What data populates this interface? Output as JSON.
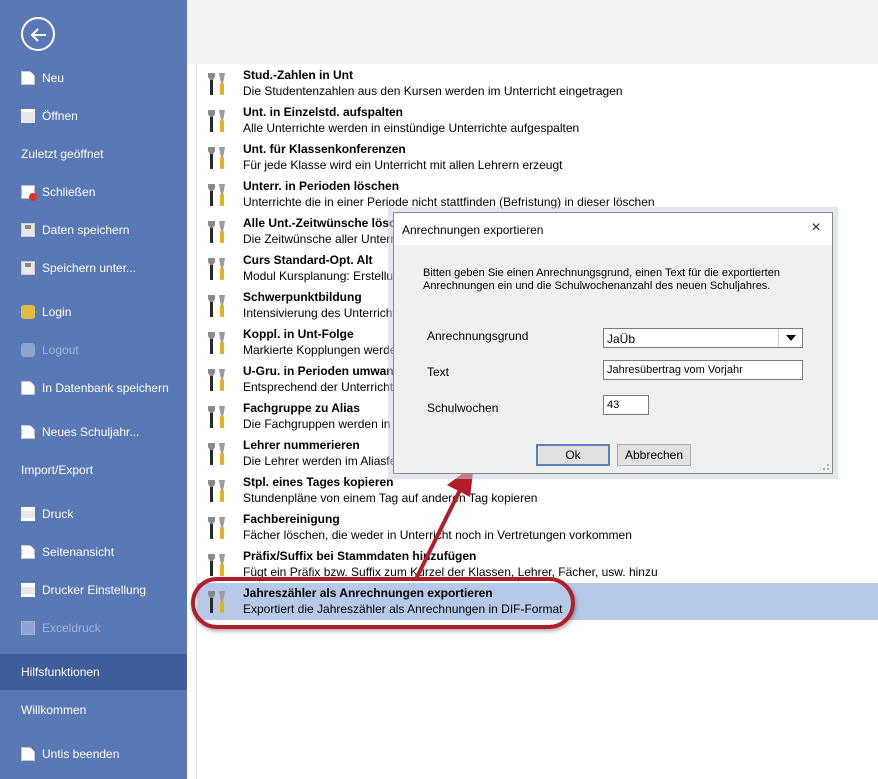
{
  "sidebar": {
    "items": [
      {
        "label": "Neu",
        "icon": "new-document-icon"
      },
      {
        "label": "Öffnen",
        "icon": "open-folder-icon"
      },
      {
        "label": "Zuletzt geöffnet"
      },
      {
        "label": "Schließen",
        "icon": "close-document-icon"
      },
      {
        "label": "Daten speichern",
        "icon": "save-disk-icon"
      },
      {
        "label": "Speichern unter...",
        "icon": "save-as-icon"
      },
      {
        "label": "Login",
        "icon": "database-icon"
      },
      {
        "label": "Logout",
        "icon": "database-icon",
        "disabled": true
      },
      {
        "label": "In Datenbank speichern",
        "icon": "database-save-icon"
      },
      {
        "label": "Neues Schuljahr...",
        "icon": "new-schoolyear-icon"
      },
      {
        "label": "Import/Export"
      },
      {
        "label": "Druck",
        "icon": "printer-icon"
      },
      {
        "label": "Seitenansicht",
        "icon": "page-preview-icon"
      },
      {
        "label": "Drucker Einstellung",
        "icon": "printer-settings-icon"
      },
      {
        "label": "Exceldruck",
        "icon": "excel-icon",
        "disabled": true
      },
      {
        "label": "Hilfsfunktionen",
        "active": true
      },
      {
        "label": "Willkommen"
      },
      {
        "label": "Untis beenden",
        "icon": "exit-icon"
      }
    ]
  },
  "functions": [
    {
      "title": "Stud.-Zahlen in Unt",
      "desc": "Die Studentenzahlen aus den Kursen werden im Unterricht eingetragen"
    },
    {
      "title": "Unt. in Einzelstd. aufspalten",
      "desc": "Alle Unterrichte werden in einstündige Unterrichte aufgespalten"
    },
    {
      "title": "Unt. für Klassenkonferenzen",
      "desc": "Für jede Klasse wird ein Unterricht mit allen Lehrern erzeugt"
    },
    {
      "title": "Unterr. in Perioden löschen",
      "desc": "Unterrichte die in einer Periode nicht stattfinden (Befristung) in dieser löschen"
    },
    {
      "title": "Alle Unt.-Zeitwünsche lösche",
      "desc": "Die Zeitwünsche aller Unterri"
    },
    {
      "title": "Curs Standard-Opt. Alt",
      "desc": "Modul Kursplanung: Erstellun"
    },
    {
      "title": "Schwerpunktbildung",
      "desc": "Intensivierung des Unterricht"
    },
    {
      "title": "Koppl. in Unt-Folge",
      "desc": "Markierte Kopplungen werde"
    },
    {
      "title": "U-Gru. in Perioden umwande",
      "desc": "Entsprechend der Unterrichts"
    },
    {
      "title": "Fachgruppe zu Alias",
      "desc": "Die Fachgruppen werden in d"
    },
    {
      "title": "Lehrer nummerieren",
      "desc": "Die Lehrer werden im Aliasfel"
    },
    {
      "title": "Stpl. eines Tages kopieren",
      "desc": "Stundenpläne von einem Tag auf anderen Tag kopieren"
    },
    {
      "title": "Fachbereinigung",
      "desc": "Fächer löschen, die weder in Unterricht noch in Vertretungen vorkommen"
    },
    {
      "title": "Präfix/Suffix bei Stammdaten hinzufügen",
      "desc": "Fügt ein Präfix bzw. Suffix zum Kürzel der Klassen, Lehrer, Fächer, usw. hinzu"
    },
    {
      "title": "Jahreszähler als Anrechnungen exportieren",
      "desc": "Exportiert die Jahreszähler als Anrechnungen in DIF-Format",
      "selected": true
    }
  ],
  "dialog": {
    "title": "Anrechnungen exportieren",
    "close": "×",
    "message": "Bitten geben Sie einen Anrechnungsgrund, einen Text für die exportierten Anrechnungen ein und die Schulwochenanzahl des neuen Schuljahres.",
    "reason_label": "Anrechnungsgrund",
    "reason_value": "JaÜb",
    "text_label": "Text",
    "text_value": "Jahresübertrag vom Vorjahr",
    "weeks_label": "Schulwochen",
    "weeks_value": "43",
    "ok": "Ok",
    "cancel": "Abbrechen"
  },
  "colors": {
    "sidebar": "#5878b6",
    "sidebar_active": "#3d5d9b",
    "selected_row": "#b6c9e8",
    "highlight": "#b21d2a"
  }
}
